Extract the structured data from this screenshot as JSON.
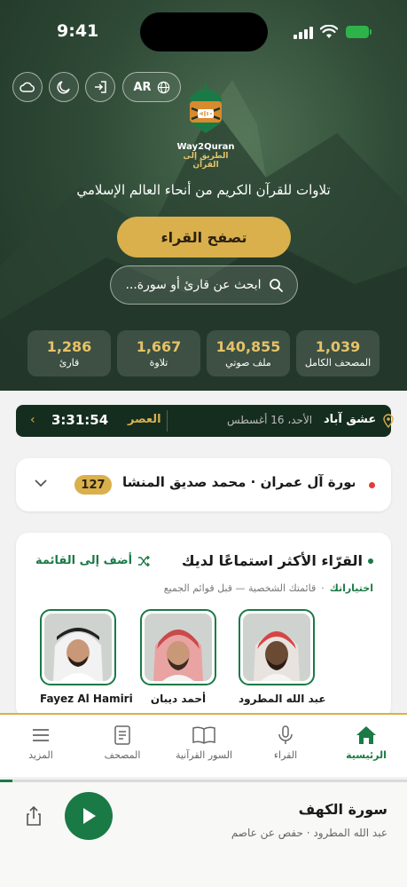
{
  "status_bar": {
    "time": "9:41"
  },
  "header": {
    "lang_label": "AR",
    "logo_text_en": "Way2Quran",
    "logo_text_ar": "الطريق إلى القرآن",
    "tagline": "تلاوات للقرآن الكريم من أنحاء العالم الإسلامي",
    "browse_button": "تصفح القراء",
    "search_placeholder": "ابحث عن قارئ أو سورة..."
  },
  "stats": [
    {
      "value": "1,039",
      "label": "المصحف الكامل"
    },
    {
      "value": "140,855",
      "label": "ملف صوتي"
    },
    {
      "value": "1,667",
      "label": "تلاوة"
    },
    {
      "value": "1,286",
      "label": "قارئ"
    }
  ],
  "prayer": {
    "city": "عشق آباد",
    "date": "الأحد، 16 أغسطس",
    "prayer_name": "العصر",
    "countdown": "3:31:54"
  },
  "now_card": {
    "title": "سورة آل عمران · محمد صديق المنشا...",
    "count": "127"
  },
  "reciters_card": {
    "title": "القرّاء الأكثر استماعًا لديك",
    "add_link": "أضف إلى القائمة",
    "picks_label": "اختياراتك",
    "sub_text": "قائمتك الشخصية — قبل قوائم الجميع",
    "reciters": [
      {
        "name": "عبد الله المطرود"
      },
      {
        "name": "أحمد ديبان"
      },
      {
        "name": "Fayez Al Hamiri"
      }
    ]
  },
  "tabs": [
    {
      "label": "الرئيسية",
      "icon": "home-icon",
      "active": true
    },
    {
      "label": "القراء",
      "icon": "microphone-icon",
      "active": false
    },
    {
      "label": "السور القرآنية",
      "icon": "open-book-icon",
      "active": false
    },
    {
      "label": "المصحف",
      "icon": "document-icon",
      "active": false
    },
    {
      "label": "المزيد",
      "icon": "menu-icon",
      "active": false
    }
  ],
  "player": {
    "title": "سورة الكهف",
    "subtitle": "عبد الله المطرود · حفص عن عاصم",
    "progress": 0.03
  },
  "colors": {
    "accent": "#1a7a45",
    "gold": "#d9b04c",
    "dark_bar": "#152d1f"
  }
}
